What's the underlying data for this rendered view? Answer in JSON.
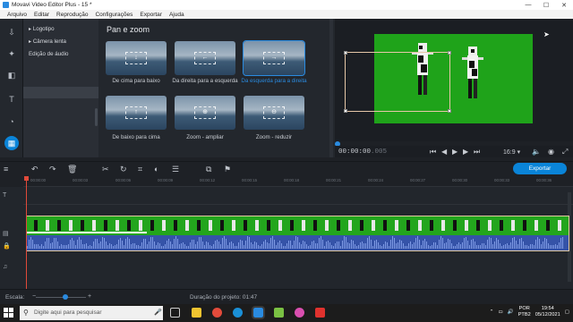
{
  "window": {
    "title": "Movavi Video Editor Plus - 15 *",
    "controls": [
      "—",
      "☐",
      "✕"
    ]
  },
  "menu": [
    "Arquivo",
    "Editar",
    "Reprodução",
    "Configurações",
    "Exportar",
    "Ajuda"
  ],
  "rail_icons": [
    "import-icon",
    "filters-icon",
    "transitions-icon",
    "titles-icon",
    "stickers-icon",
    "more-tools-icon"
  ],
  "categories": {
    "items": [
      "Logotipo",
      "Câmera lenta",
      "Edição de áudio"
    ],
    "selected_index": 3
  },
  "effects": {
    "heading": "Pan e zoom",
    "tiles": [
      {
        "label": "De cima para baixo",
        "glyph": "↓"
      },
      {
        "label": "Da direita para a esquerda",
        "glyph": "←"
      },
      {
        "label": "Da esquerda para a direita",
        "glyph": "→",
        "selected": true
      },
      {
        "label": "De baixo para cima",
        "glyph": "↑"
      },
      {
        "label": "Zoom - ampliar",
        "glyph": "⊕"
      },
      {
        "label": "Zoom - reduzir",
        "glyph": "⊖"
      }
    ]
  },
  "player": {
    "time_main": "00:00:00",
    "time_ms": ".005",
    "aspect": "16:9",
    "aspect_caret": "▾"
  },
  "export_label": "Exportar",
  "ruler": [
    "00:00:00",
    "00:00:03",
    "00:00:06",
    "00:00:09",
    "00:00:12",
    "00:00:15",
    "00:00:18",
    "00:00:21",
    "00:00:24",
    "00:00:27",
    "00:00:30",
    "00:00:33",
    "00:00:36"
  ],
  "status": {
    "scale_label": "Escala:",
    "duration_label": "Duração do projeto: 01:47"
  },
  "taskbar": {
    "search_placeholder": "Digite aqui para pesquisar",
    "lang": "POR",
    "lang2": "PTB2",
    "time": "19:54",
    "date": "05/12/2021"
  },
  "colors": {
    "accent": "#0a84d8",
    "chroma": "#23a51d",
    "audio": "#3553a8",
    "playhead": "#e04a3a"
  }
}
